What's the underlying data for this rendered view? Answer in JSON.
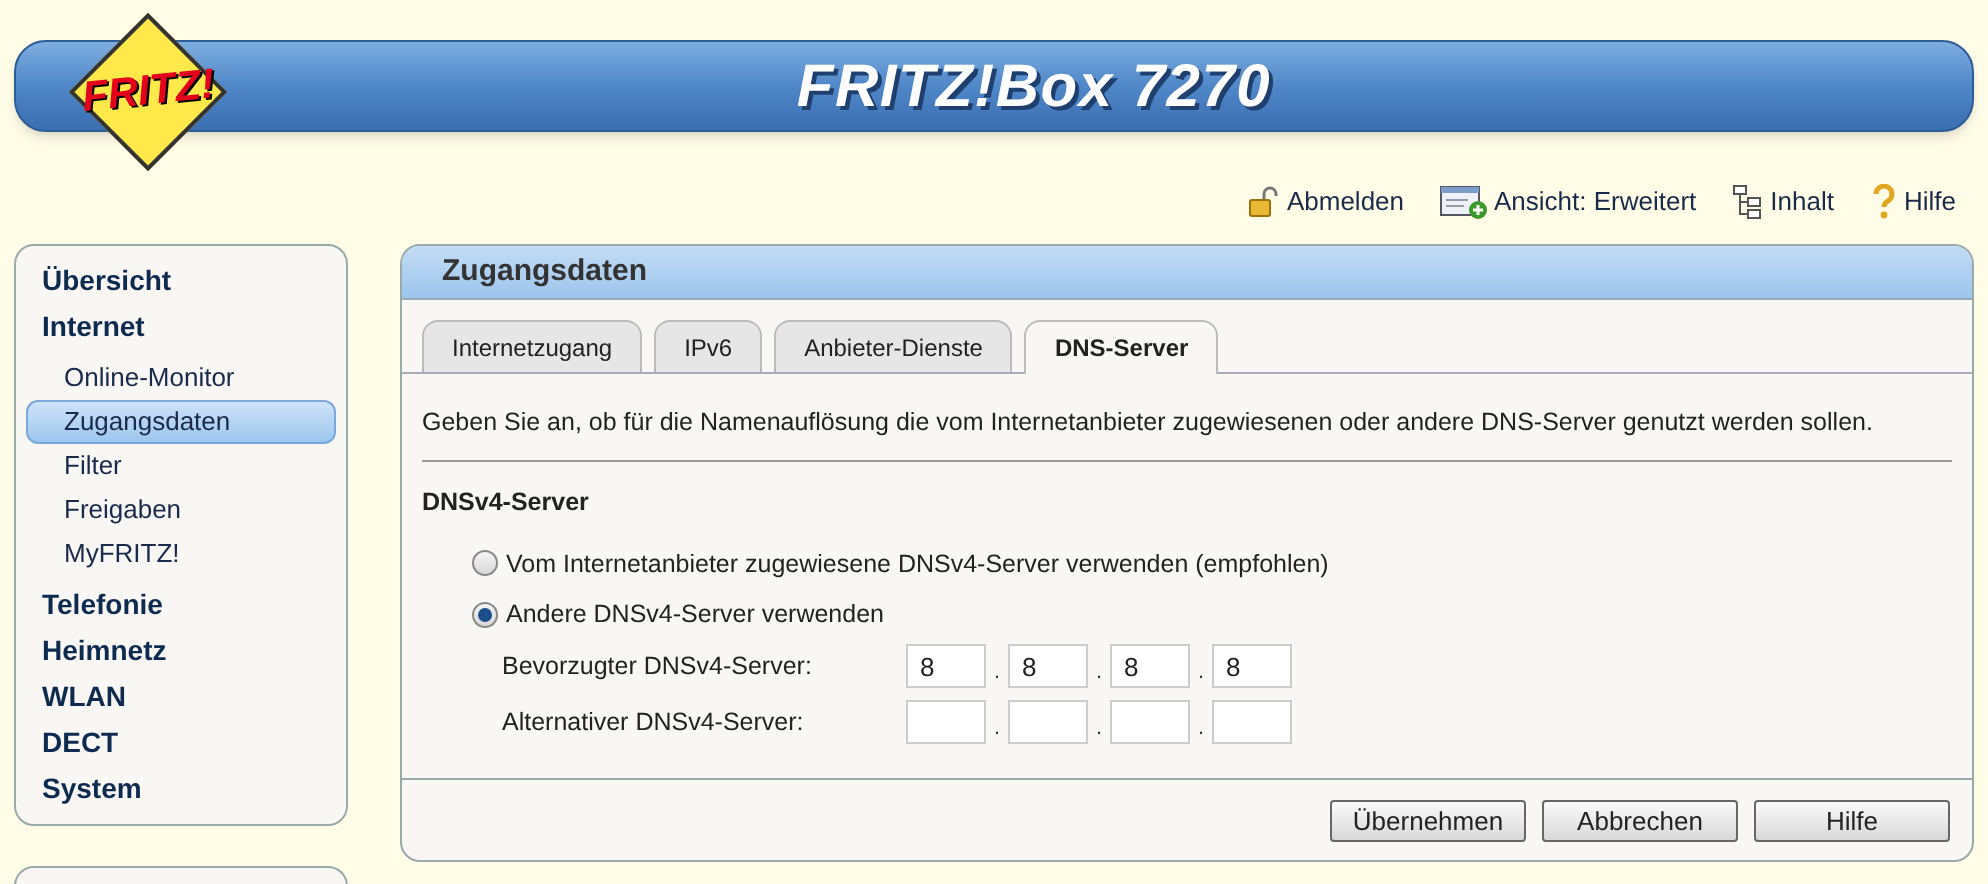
{
  "header": {
    "logo": "FRITZ!",
    "title": "FRITZ!Box 7270"
  },
  "top_links": [
    {
      "label": "Abmelden",
      "kind": "logout"
    },
    {
      "label": "Ansicht: Erweitert",
      "kind": "view"
    },
    {
      "label": "Inhalt",
      "kind": "content"
    },
    {
      "label": "Hilfe",
      "kind": "help"
    }
  ],
  "sidebar": {
    "items": [
      {
        "label": "Übersicht",
        "selected": false
      },
      {
        "label": "Internet",
        "selected": false,
        "children": [
          {
            "label": "Online-Monitor",
            "selected": false
          },
          {
            "label": "Zugangsdaten",
            "selected": true
          },
          {
            "label": "Filter",
            "selected": false
          },
          {
            "label": "Freigaben",
            "selected": false
          },
          {
            "label": "MyFRITZ!",
            "selected": false
          }
        ]
      },
      {
        "label": "Telefonie",
        "selected": false
      },
      {
        "label": "Heimnetz",
        "selected": false
      },
      {
        "label": "WLAN",
        "selected": false
      },
      {
        "label": "DECT",
        "selected": false
      },
      {
        "label": "System",
        "selected": false
      }
    ]
  },
  "panel": {
    "title": "Zugangsdaten",
    "tabs": [
      {
        "label": "Internetzugang",
        "selected": false
      },
      {
        "label": "IPv6",
        "selected": false
      },
      {
        "label": "Anbieter-Dienste",
        "selected": false
      },
      {
        "label": "DNS-Server",
        "selected": true
      }
    ],
    "intro": "Geben Sie an, ob für die Namenauflösung die vom Internetanbieter zugewiesenen oder andere DNS-Server genutzt werden sollen.",
    "section_title": "DNSv4-Server",
    "options": [
      {
        "label": "Vom Internetanbieter zugewiesene DNSv4-Server verwenden (empfohlen)",
        "selected": false
      },
      {
        "label": "Andere DNSv4-Server verwenden",
        "selected": true
      }
    ],
    "servers": [
      {
        "label": "Bevorzugter DNSv4-Server:",
        "octets": [
          {
            "kind": "octet",
            "value": "8"
          },
          {
            "kind": "octet",
            "value": "8"
          },
          {
            "kind": "octet",
            "value": "8"
          },
          {
            "kind": "octet",
            "value": "8"
          }
        ]
      },
      {
        "label": "Alternativer DNSv4-Server:",
        "octets": [
          {
            "kind": "octet"
          },
          {
            "kind": "octet"
          },
          {
            "kind": "octet"
          },
          {
            "kind": "octet"
          }
        ]
      }
    ],
    "separator": ".",
    "buttons": [
      "Übernehmen",
      "Abbrechen",
      "Hilfe"
    ]
  }
}
